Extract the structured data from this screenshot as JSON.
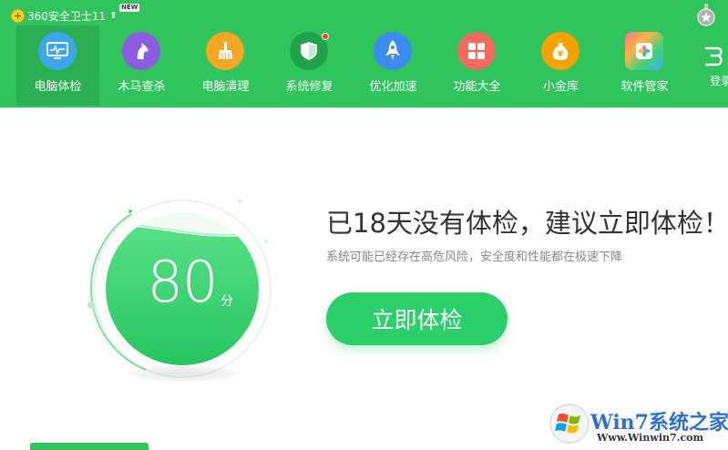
{
  "app": {
    "title": "360安全卫士11",
    "new_badge": "NEW"
  },
  "nav": {
    "items": [
      {
        "label": "电脑体检",
        "icon": "monitor-pulse-icon",
        "color": "#3da6ee"
      },
      {
        "label": "木马查杀",
        "icon": "horse-icon",
        "color": "#8c5be0"
      },
      {
        "label": "电脑清理",
        "icon": "broom-icon",
        "color": "#f5a623"
      },
      {
        "label": "系统修复",
        "icon": "shield-icon",
        "color": "#1fa24a"
      },
      {
        "label": "优化加速",
        "icon": "rocket-icon",
        "color": "#3b8cf0"
      },
      {
        "label": "功能大全",
        "icon": "grid-icon",
        "color": "#f36b5c"
      },
      {
        "label": "小金库",
        "icon": "money-bag-icon",
        "color": "#f5a300"
      },
      {
        "label": "软件管家",
        "icon": "software-box-icon",
        "color": "#ffffff"
      }
    ],
    "login_label": "登录"
  },
  "score": {
    "value": "80",
    "unit": "分"
  },
  "main": {
    "headline": "已18天没有体检，建议立即体检！",
    "subtext": "系统可能已经存在高危风险，安全度和性能都在极速下降",
    "button_label": "立即体检"
  },
  "watermark": {
    "brand": "Win7系统之家",
    "url": "Www.Winwin7.com"
  },
  "colors": {
    "brand_green": "#2fc45c",
    "button_green": "#2bd06a"
  }
}
